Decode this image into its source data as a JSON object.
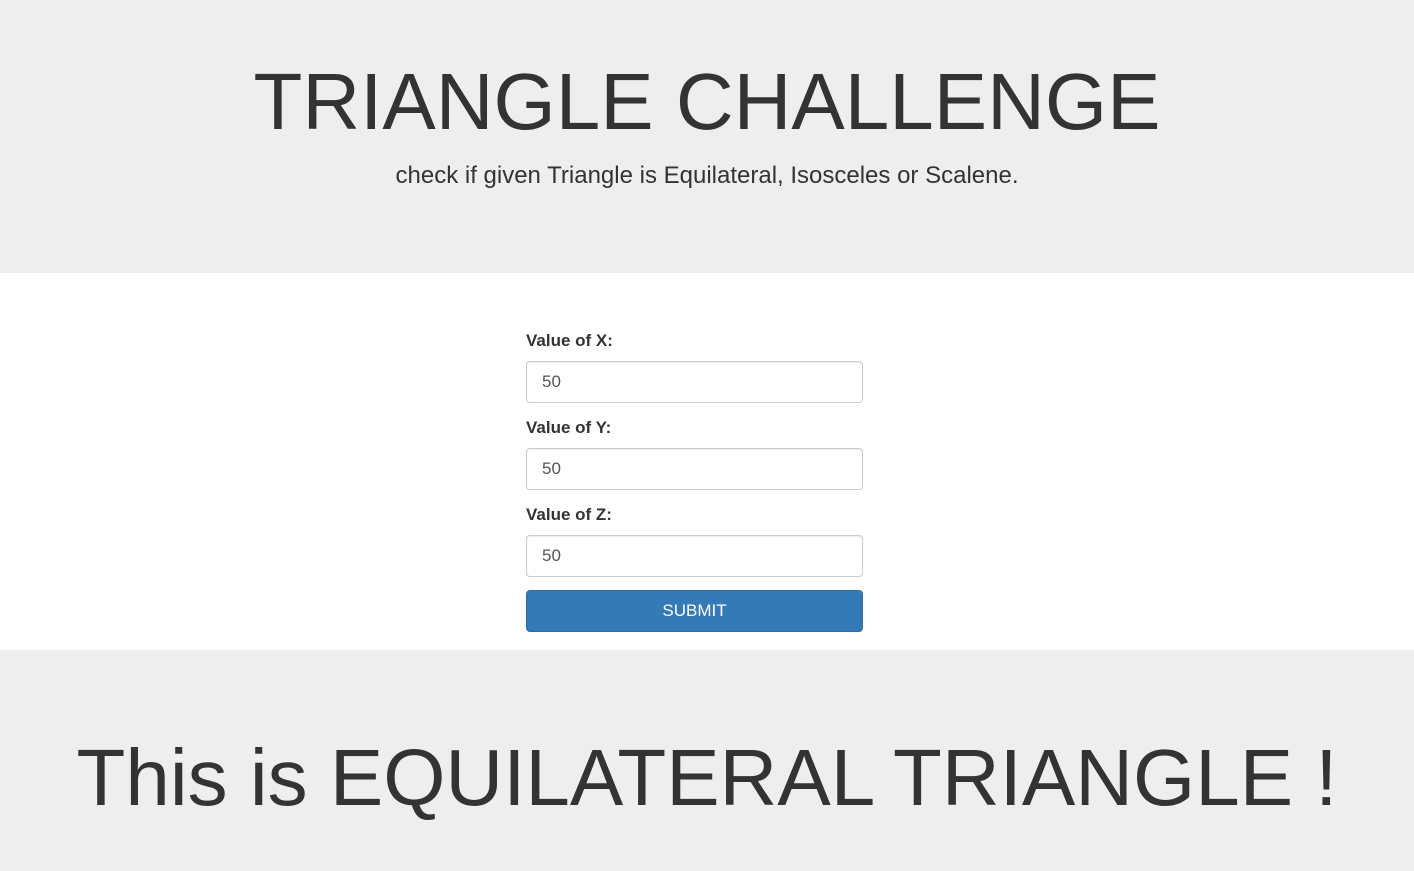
{
  "header": {
    "title": "TRIANGLE CHALLENGE",
    "subtitle": "check if given Triangle is Equilateral, Isosceles or Scalene."
  },
  "form": {
    "fields": [
      {
        "label": "Value of X:",
        "value": "50"
      },
      {
        "label": "Value of Y:",
        "value": "50"
      },
      {
        "label": "Value of Z:",
        "value": "50"
      }
    ],
    "submit_label": "SUBMIT"
  },
  "result": {
    "text": "This is EQUILATERAL TRIANGLE !"
  },
  "colors": {
    "jumbotron_bg": "#eeeeee",
    "primary_button": "#337ab7",
    "text": "#333333"
  }
}
